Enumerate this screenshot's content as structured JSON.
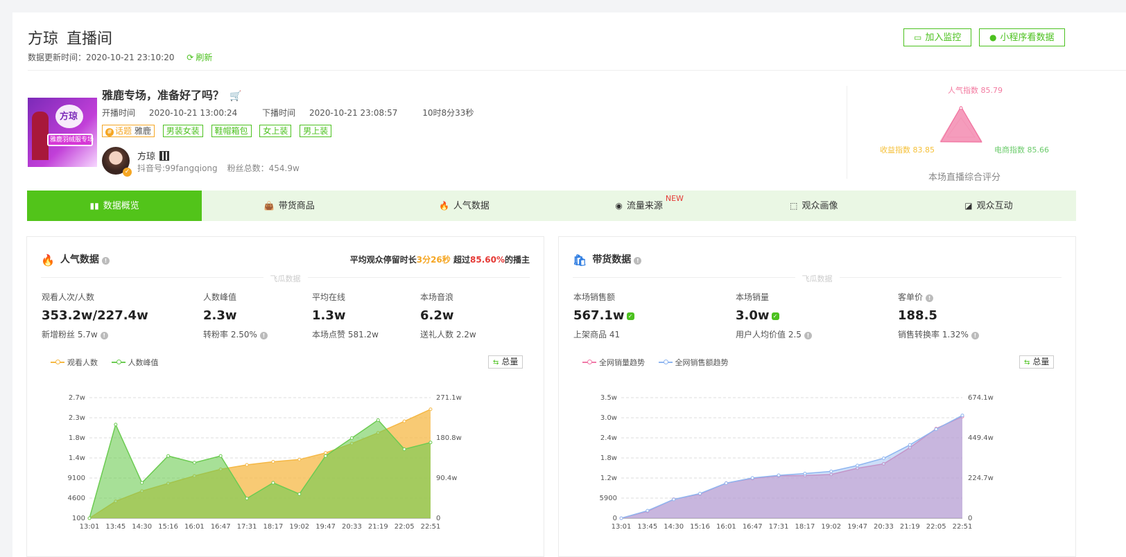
{
  "header": {
    "anchor_name": "方琼",
    "page_name": "直播间",
    "update_label": "数据更新时间：",
    "update_time": "2020-10-21 23:10:20",
    "refresh_label": "刷新",
    "monitor_button": "加入监控",
    "mini_program_button": "小程序看数据"
  },
  "live": {
    "cover_text": "方琼",
    "cover_subtitle": "雅鹿羽绒服专场",
    "title": "雅鹿专场，准备好了吗？",
    "start_label": "开播时间",
    "start_time": "2020-10-21 13:00:24",
    "end_label": "下播时间",
    "end_time": "2020-10-21 23:08:57",
    "duration": "10时8分33秒",
    "topic_label": "话题",
    "topic_value": "雅鹿",
    "tags": [
      "男装女装",
      "鞋帽箱包",
      "女上装",
      "男上装"
    ],
    "anchor": {
      "name": "方琼",
      "douyin_id": "抖音号:99fangqiong",
      "fans": "粉丝总数：454.9w"
    }
  },
  "radar": {
    "popularity": "人气指数 85.79",
    "revenue": "收益指数 83.85",
    "ecommerce": "电商指数 85.66",
    "caption": "本场直播综合评分",
    "values": [
      85.79,
      85.66,
      83.85
    ],
    "colors": {
      "popularity": "#f37aa0",
      "revenue": "#f5c038",
      "ecommerce": "#6bcb6b"
    }
  },
  "tabs": [
    {
      "label": "数据概览",
      "icon": "bar-chart-icon",
      "active": true
    },
    {
      "label": "带货商品",
      "icon": "shopping-bag-icon"
    },
    {
      "label": "人气数据",
      "icon": "flame-icon"
    },
    {
      "label": "流量来源",
      "icon": "pulse-icon",
      "badge": "NEW"
    },
    {
      "label": "观众画像",
      "icon": "portrait-icon"
    },
    {
      "label": "观众互动",
      "icon": "chat-icon"
    }
  ],
  "popularity_card": {
    "title": "人气数据",
    "stay_prefix": "平均观众停留时长",
    "stay_time": "3分26秒",
    "stay_mid": "超过",
    "stay_pct": "85.60%",
    "stay_suffix": "的播主",
    "watermark": "飞瓜数据",
    "kpis": [
      {
        "label": "观看人次/人数",
        "value": "353.2w/227.4w",
        "sub": "新增粉丝 5.7w",
        "sub_info": true
      },
      {
        "label": "人数峰值",
        "value": "2.3w",
        "sub": "转粉率 2.50%",
        "sub_info": true
      },
      {
        "label": "平均在线",
        "value": "1.3w",
        "sub": "本场点赞 581.2w"
      },
      {
        "label": "本场音浪",
        "value": "6.2w",
        "sub": "送礼人数 2.2w"
      }
    ],
    "legend": [
      {
        "label": "观看人数",
        "color": "#f5b845"
      },
      {
        "label": "人数峰值",
        "color": "#6ccb52"
      }
    ],
    "total_button": "总量"
  },
  "sales_card": {
    "title": "带货数据",
    "watermark": "飞瓜数据",
    "kpis": [
      {
        "label": "本场销售额",
        "value": "567.1w",
        "verified": true,
        "sub": "上架商品 41"
      },
      {
        "label": "本场销量",
        "value": "3.0w",
        "verified": true,
        "sub": "用户人均价值 2.5",
        "sub_info": true
      },
      {
        "label": "客单价",
        "value": "188.5",
        "label_info": true,
        "sub": "销售转换率 1.32%",
        "sub_info": true
      }
    ],
    "legend": [
      {
        "label": "全网销量趋势",
        "color": "#f07aa8"
      },
      {
        "label": "全网销售额趋势",
        "color": "#8fb6f0"
      }
    ],
    "total_button": "总量"
  },
  "chart_data": [
    {
      "type": "area",
      "x": [
        "13:01",
        "13:45",
        "14:30",
        "15:16",
        "16:01",
        "16:47",
        "17:31",
        "18:17",
        "19:02",
        "19:47",
        "20:33",
        "21:19",
        "22:05",
        "22:51"
      ],
      "left_axis_ticks": [
        "100",
        "4600",
        "9100",
        "1.4w",
        "1.8w",
        "2.3w",
        "2.7w"
      ],
      "right_axis_ticks": [
        "0",
        "90.4w",
        "180.8w",
        "271.1w"
      ],
      "ylim_left": [
        100,
        27000
      ],
      "ylim_right": [
        0,
        2711000
      ],
      "series": [
        {
          "name": "观看人数",
          "axis": "right",
          "color": "#f5b845",
          "values": [
            0,
            380000,
            610000,
            780000,
            950000,
            1100000,
            1200000,
            1270000,
            1320000,
            1470000,
            1680000,
            1920000,
            2180000,
            2450000
          ]
        },
        {
          "name": "人数峰值",
          "axis": "left",
          "color": "#6ccb52",
          "values": [
            100,
            21000,
            8000,
            14000,
            12500,
            14000,
            4500,
            8000,
            5500,
            14000,
            18000,
            22000,
            15500,
            17000
          ]
        }
      ]
    },
    {
      "type": "area",
      "x": [
        "13:01",
        "13:45",
        "14:30",
        "15:16",
        "16:01",
        "16:47",
        "17:31",
        "18:17",
        "19:02",
        "19:47",
        "20:33",
        "21:19",
        "22:05",
        "22:51"
      ],
      "left_axis_ticks": [
        "0",
        "5900",
        "1.2w",
        "1.8w",
        "2.4w",
        "3.0w",
        "3.5w"
      ],
      "right_axis_ticks": [
        "0",
        "224.7w",
        "449.4w",
        "674.1w"
      ],
      "ylim_left": [
        0,
        35000
      ],
      "ylim_right": [
        0,
        6741000
      ],
      "series": [
        {
          "name": "全网销量趋势",
          "axis": "left",
          "color": "#f07aa8",
          "values": [
            0,
            2000,
            5500,
            7000,
            10200,
            11500,
            12300,
            12400,
            12700,
            14500,
            15800,
            20500,
            26000,
            29500
          ]
        },
        {
          "name": "全网销售额趋势",
          "axis": "right",
          "color": "#8fb6f0",
          "values": [
            0,
            420000,
            1050000,
            1380000,
            1960000,
            2250000,
            2400000,
            2500000,
            2620000,
            2950000,
            3350000,
            4100000,
            4980000,
            5750000
          ]
        }
      ]
    }
  ]
}
